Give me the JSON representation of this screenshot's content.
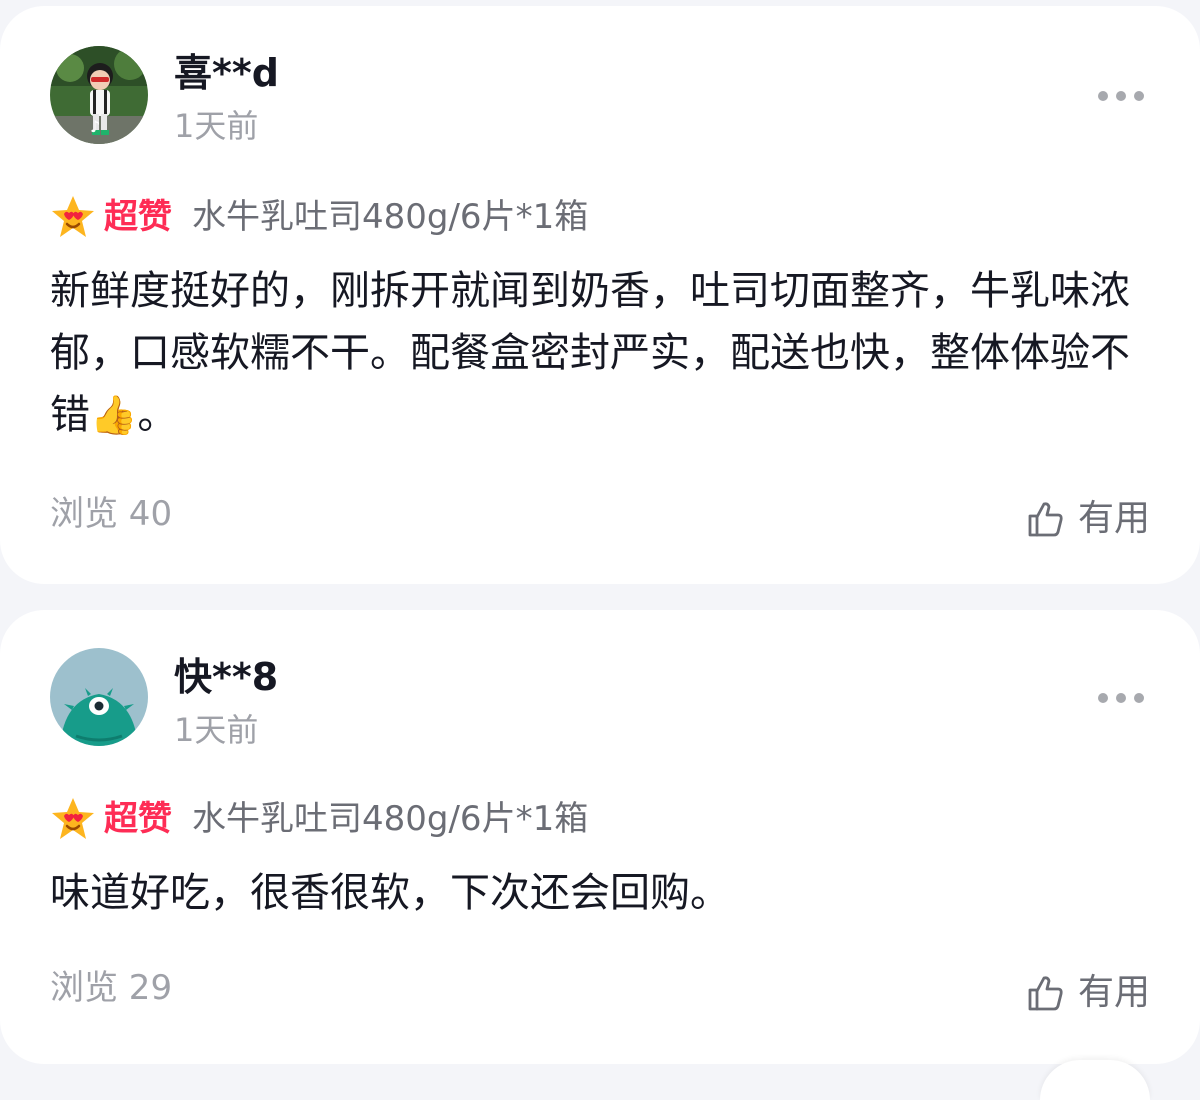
{
  "reviews": [
    {
      "username": "喜**d",
      "time": "1天前",
      "rating_label": "超赞",
      "product_spec": "水牛乳吐司480g/6片*1箱",
      "text": "新鲜度挺好的，刚拆开就闻到奶香，吐司切面整齐，牛乳味浓郁，口感软糯不干。配餐盒密封严实，配送也快，整体体验不错",
      "text_emoji": "👍",
      "text_end": "。",
      "views": "浏览 40",
      "helpful_label": "有用"
    },
    {
      "username": "快**8",
      "time": "1天前",
      "rating_label": "超赞",
      "product_spec": "水牛乳吐司480g/6片*1箱",
      "text": "味道好吃，很香很软，下次还会回购。",
      "views": "浏览 29",
      "helpful_label": "有用"
    }
  ],
  "icons": {
    "more": "more-dots-icon",
    "helpful": "thumbs-up-outline-icon",
    "rating": "star-heart-eyes-emoji"
  },
  "colors": {
    "accent": "#fe2c55",
    "text_primary": "#161823",
    "text_secondary": "#9fa1a8",
    "background": "#f4f5f9"
  }
}
